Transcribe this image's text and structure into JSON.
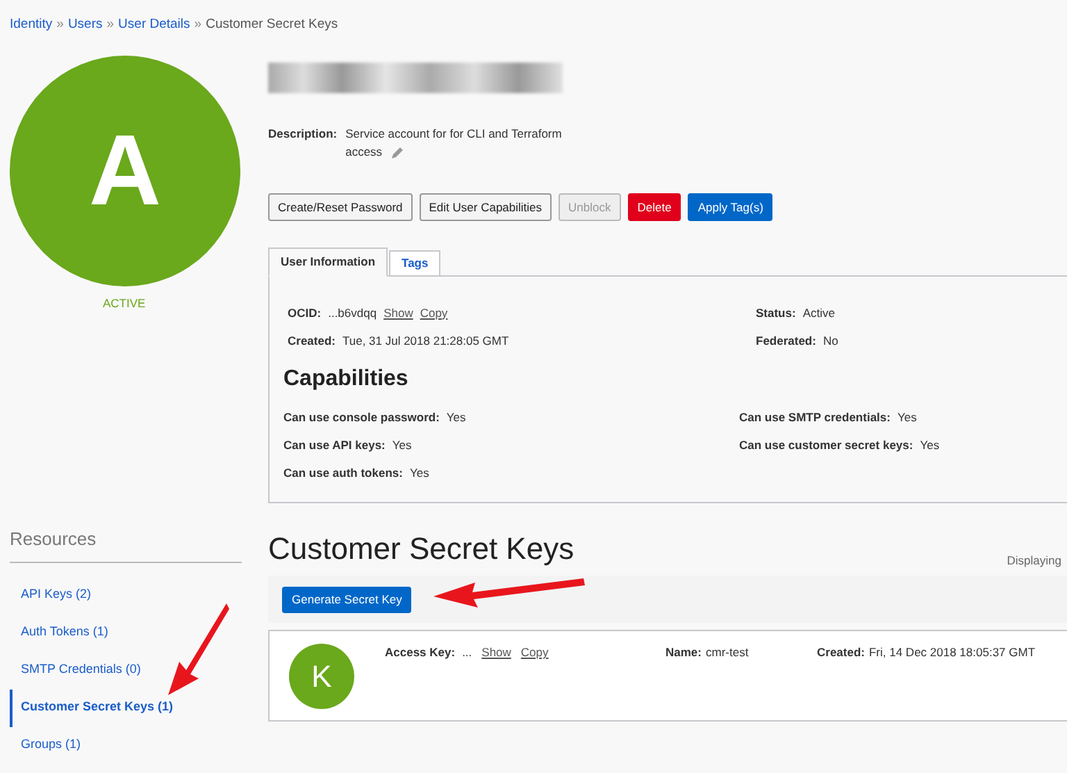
{
  "breadcrumb": [
    {
      "label": "Identity",
      "link": true
    },
    {
      "label": "Users",
      "link": true
    },
    {
      "label": "User Details",
      "link": true
    },
    {
      "label": "Customer Secret Keys",
      "link": false
    }
  ],
  "breadcrumb_separator": "»",
  "avatar": {
    "letter": "A",
    "status": "ACTIVE"
  },
  "description": {
    "label": "Description:",
    "lines": [
      "Service account for for CLI and Terraform",
      "access"
    ]
  },
  "buttons": [
    {
      "label": "Create/Reset Password",
      "kind": "default",
      "disabled": false
    },
    {
      "label": "Edit User Capabilities",
      "kind": "default",
      "disabled": false
    },
    {
      "label": "Unblock",
      "kind": "default",
      "disabled": true
    },
    {
      "label": "Delete",
      "kind": "danger",
      "disabled": false
    },
    {
      "label": "Apply Tag(s)",
      "kind": "primary",
      "disabled": false
    }
  ],
  "tabs": [
    {
      "label": "User Information",
      "selected": true
    },
    {
      "label": "Tags",
      "selected": false
    }
  ],
  "info": {
    "ocid_label": "OCID:",
    "ocid": "...b6vdqq",
    "show": "Show",
    "copy": "Copy",
    "created_label": "Created:",
    "created": "Tue, 31 Jul 2018 21:28:05 GMT",
    "status_label": "Status:",
    "status": "Active",
    "federated_label": "Federated:",
    "federated": "No"
  },
  "capabilities": {
    "title": "Capabilities",
    "items": [
      {
        "label": "Can use console password:",
        "value": "Yes"
      },
      {
        "label": "Can use SMTP credentials:",
        "value": "Yes"
      },
      {
        "label": "Can use API keys:",
        "value": "Yes"
      },
      {
        "label": "Can use customer secret keys:",
        "value": "Yes"
      },
      {
        "label": "Can use auth tokens:",
        "value": "Yes"
      }
    ]
  },
  "resources": {
    "title": "Resources",
    "items": [
      {
        "label": "API Keys (2)",
        "selected": false
      },
      {
        "label": "Auth Tokens (1)",
        "selected": false
      },
      {
        "label": "SMTP Credentials (0)",
        "selected": false
      },
      {
        "label": "Customer Secret Keys (1)",
        "selected": true
      },
      {
        "label": "Groups (1)",
        "selected": false
      }
    ]
  },
  "section": {
    "title": "Customer Secret Keys",
    "displaying": "Displaying",
    "generate_button": "Generate Secret Key"
  },
  "keys": [
    {
      "letter": "K",
      "access_label": "Access Key:",
      "access": "...",
      "show": "Show",
      "copy": "Copy",
      "name_label": "Name:",
      "name": "cmr-test",
      "created_label": "Created:",
      "created": "Fri, 14 Dec 2018 18:05:37 GMT"
    }
  ]
}
